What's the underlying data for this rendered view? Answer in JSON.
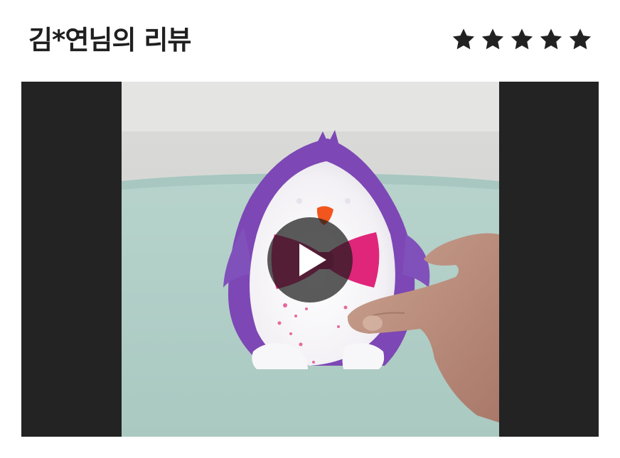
{
  "review": {
    "title": "김*연님의 리뷰",
    "rating": 5,
    "rating_max": 5,
    "star_color": "#222222"
  },
  "video": {
    "letterbox_color": "#232323",
    "play_icon": "play-icon"
  }
}
